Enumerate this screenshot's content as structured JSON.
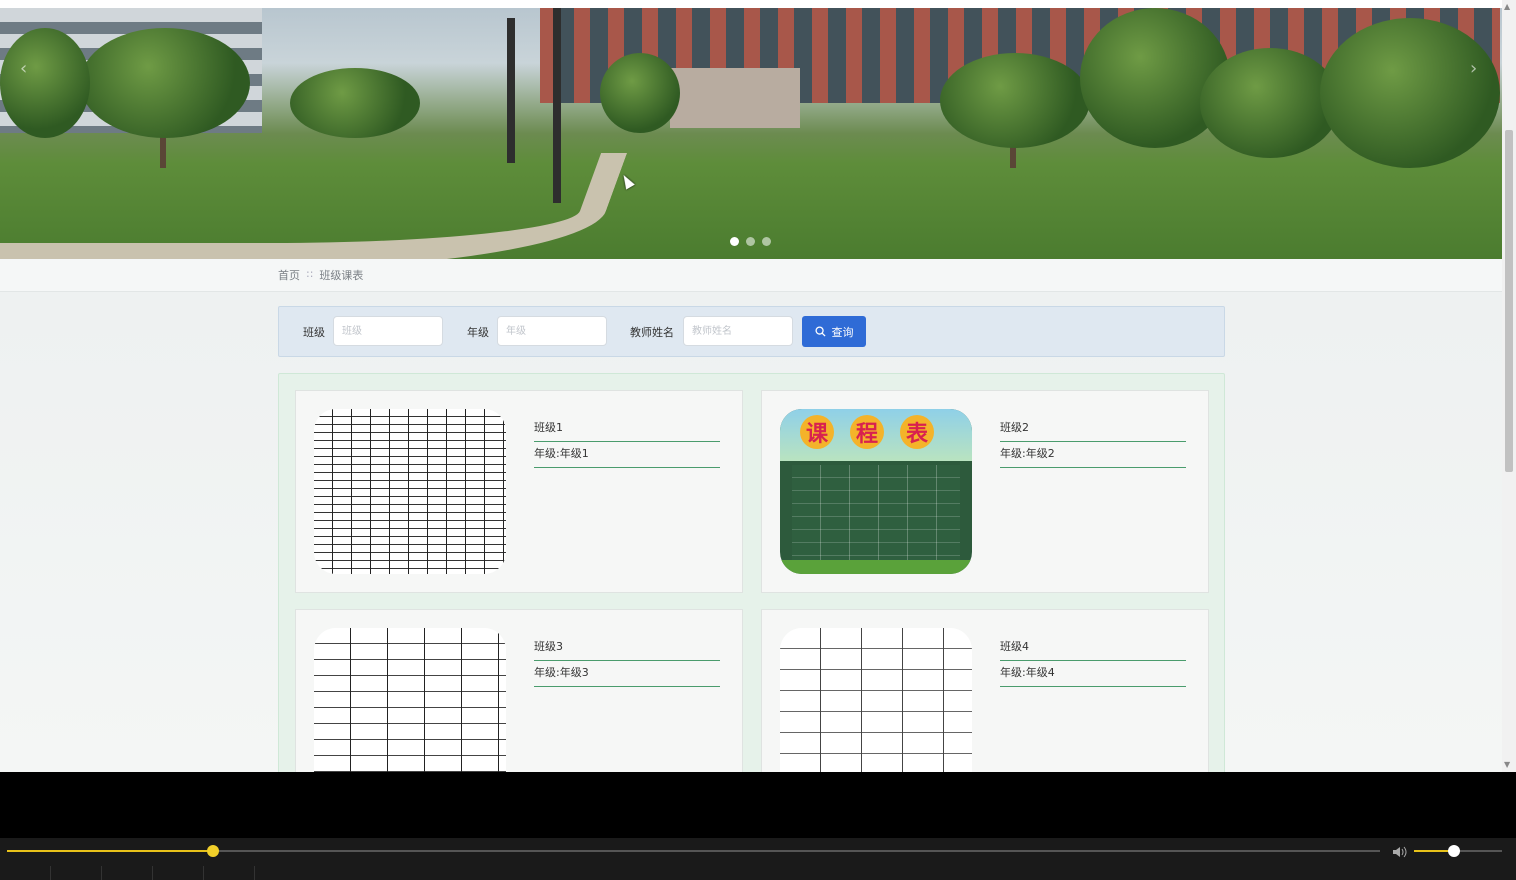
{
  "breadcrumb": {
    "home": "首页",
    "separator": "::",
    "current": "班级课表"
  },
  "search": {
    "class_label": "班级",
    "class_placeholder": "班级",
    "grade_label": "年级",
    "grade_placeholder": "年级",
    "teacher_label": "教师姓名",
    "teacher_placeholder": "教师姓名",
    "button_label": "查询",
    "button_icon": "search-icon"
  },
  "board_title": [
    "课",
    "程",
    "表"
  ],
  "cards": [
    {
      "name": "班级1",
      "grade": "年级:年级1"
    },
    {
      "name": "班级2",
      "grade": "年级:年级2"
    },
    {
      "name": "班级3",
      "grade": "年级:年级3"
    },
    {
      "name": "班级4",
      "grade": "年级:年级4"
    }
  ],
  "carousel": {
    "slides": 3,
    "active_index": 0
  },
  "player": {
    "progress": 0.15,
    "volume": 0.45
  },
  "colors": {
    "accent": "#2f6bd6",
    "underline": "#4a9c6d",
    "seek": "#e8c21a"
  }
}
